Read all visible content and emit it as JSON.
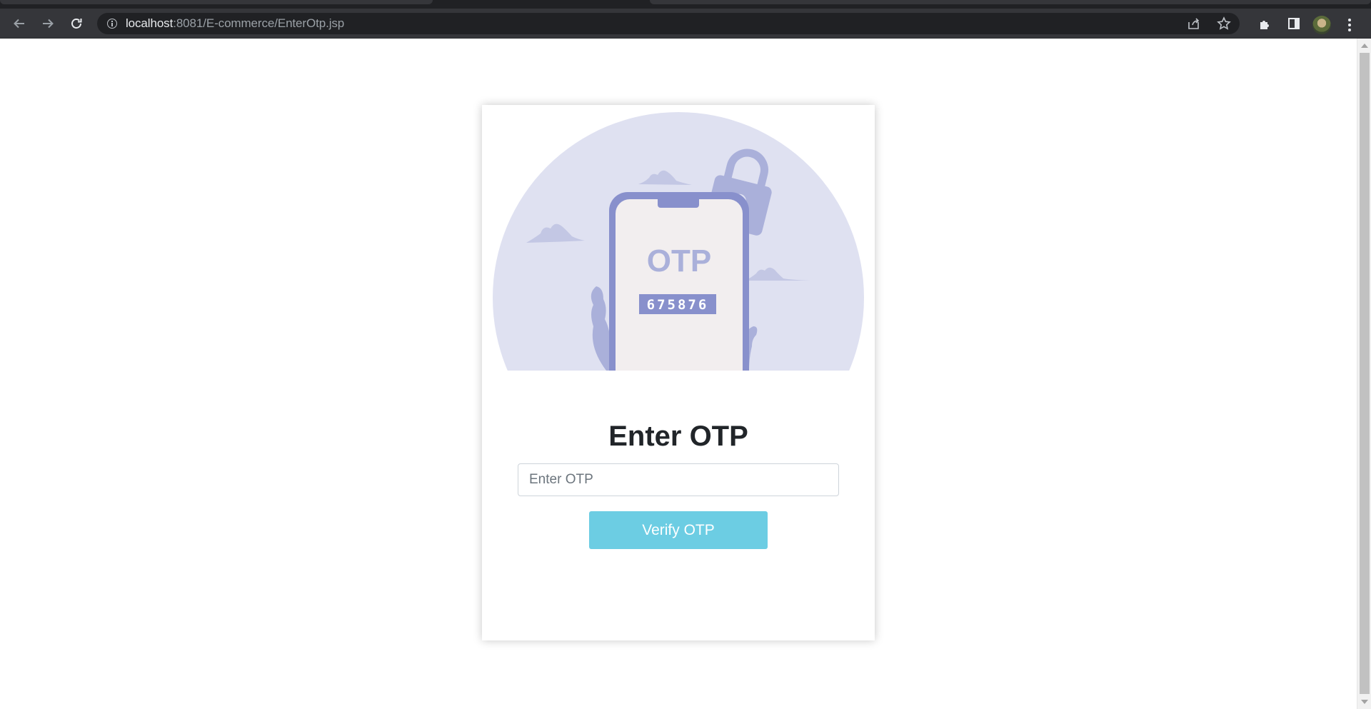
{
  "browser": {
    "url_host": "localhost",
    "url_path": ":8081/E-commerce/EnterOtp.jsp"
  },
  "illustration": {
    "otp_label": "OTP",
    "otp_code": "675876",
    "colors": {
      "circle": "#dfe1f1",
      "phone": "#8890cc",
      "screen": "#f2eeef",
      "lock": "#aab0da",
      "cloud": "#c3c7e4"
    }
  },
  "form": {
    "title": "Enter OTP",
    "input_placeholder": "Enter OTP",
    "button_label": "Verify OTP",
    "button_color": "#6ccde3"
  }
}
